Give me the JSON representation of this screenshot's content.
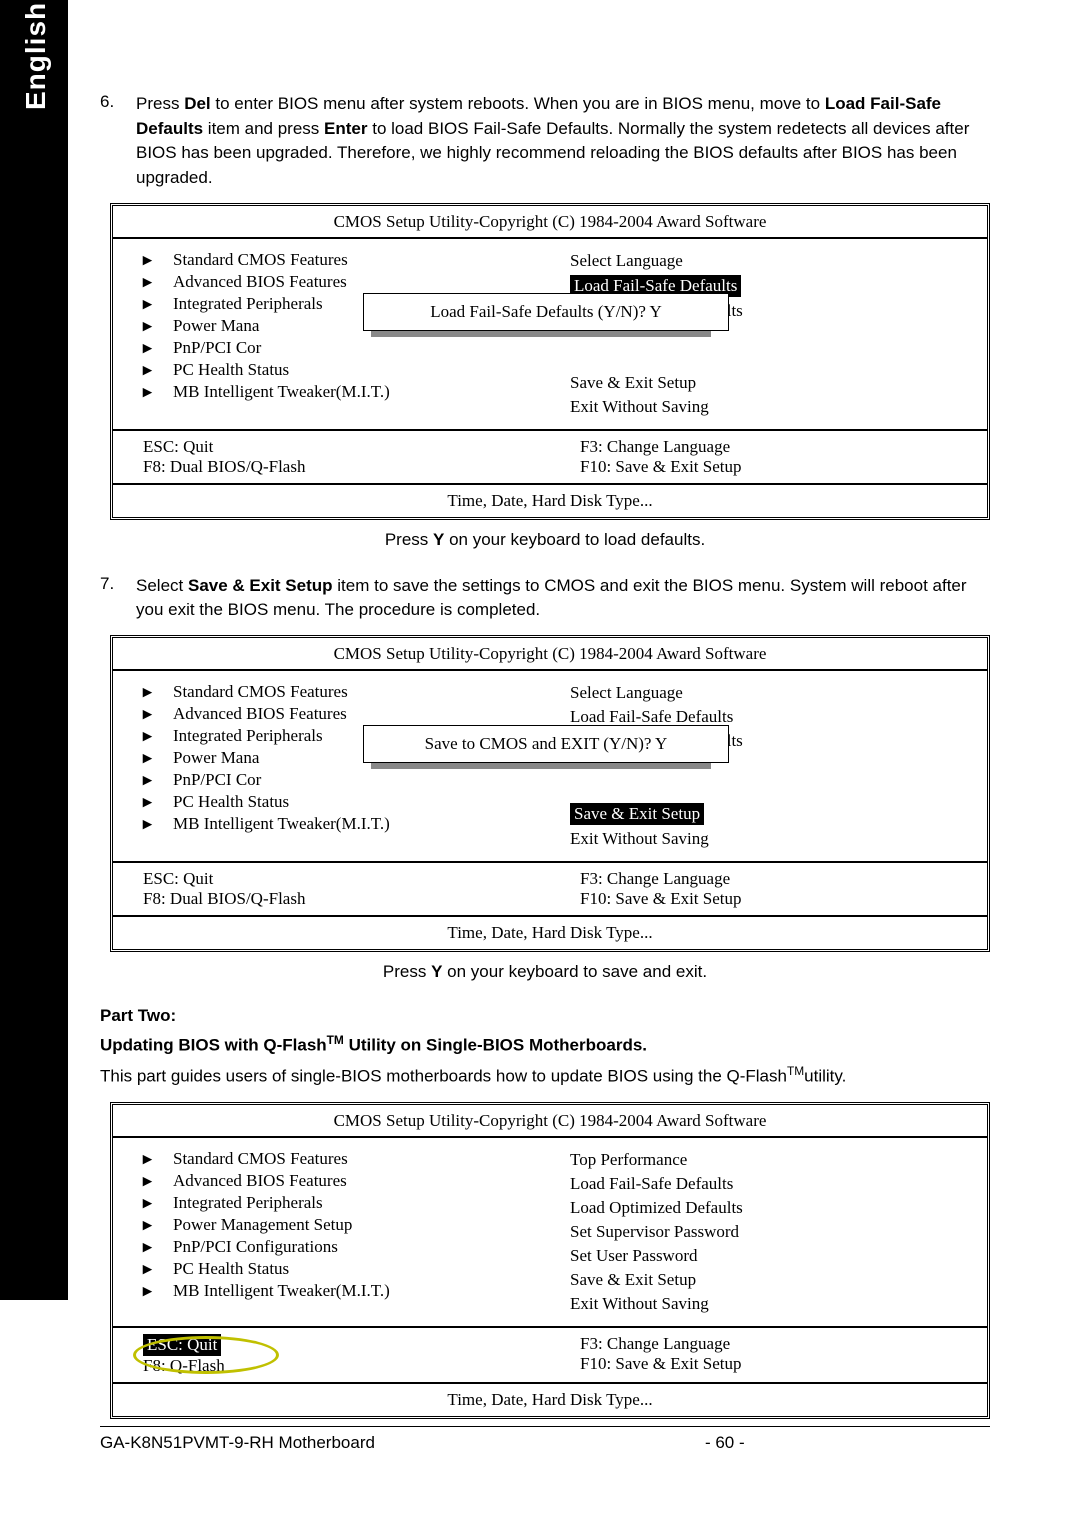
{
  "lang_tab": "English",
  "step6": {
    "num": "6.",
    "t1": "Press ",
    "del": "Del",
    "t2": " to enter BIOS menu after system reboots. When you are in BIOS menu, move to ",
    "lfsd": "Load Fail-Safe Defaults",
    "t3": " item and press ",
    "enter": "Enter",
    "t4": " to load BIOS Fail-Safe Defaults. Normally the system redetects all devices after BIOS has been upgraded. Therefore, we highly recommend reloading the BIOS defaults after BIOS has been upgraded."
  },
  "bios_common": {
    "title": "CMOS Setup Utility-Copyright (C) 1984-2004 Award Software",
    "left": [
      "Standard CMOS Features",
      "Advanced BIOS Features",
      "Integrated Peripherals",
      "Power Mana",
      "PnP/PCI Cor",
      "PC Health Status",
      "MB Intelligent Tweaker(M.I.T.)"
    ],
    "left_full": [
      "Standard CMOS Features",
      "Advanced BIOS Features",
      "Integrated Peripherals",
      "Power Management Setup",
      "PnP/PCI Configurations",
      "PC Health Status",
      "MB Intelligent Tweaker(M.I.T.)"
    ],
    "keys": {
      "esc": "ESC: Quit",
      "f8a": "F8: Dual BIOS/Q-Flash",
      "f8b": "F8: Q-Flash",
      "f3": "F3: Change Language",
      "f10": "F10: Save & Exit Setup"
    },
    "footer": "Time, Date, Hard Disk Type..."
  },
  "bios1": {
    "right": [
      "Select Language",
      "Load Fail-Safe Defaults",
      "Load Optimized Defaults",
      "",
      "",
      "Save & Exit Setup",
      "Exit Without Saving"
    ],
    "dialog": "Load Fail-Safe Defaults (Y/N)? Y",
    "caption_pre": "Press ",
    "caption_key": "Y",
    "caption_post": " on your keyboard to load defaults."
  },
  "step7": {
    "num": "7.",
    "t1": "Select ",
    "ses": "Save & Exit Setup",
    "t2": " item to save the settings to CMOS and exit the BIOS menu. System will reboot after you exit the BIOS menu. The procedure is completed."
  },
  "bios2": {
    "right": [
      "Select Language",
      "Load Fail-Safe Defaults",
      "Load Optimized Defaults",
      "",
      "",
      "Save & Exit Setup",
      "Exit Without Saving"
    ],
    "dialog": "Save to CMOS and EXIT (Y/N)? Y",
    "caption_pre": "Press ",
    "caption_key": "Y",
    "caption_post": " on your keyboard to save and exit."
  },
  "part2": {
    "title": "Part Two:",
    "sub_pre": "Updating BIOS with Q-Flash",
    "sub_tm": "TM",
    "sub_post": " Utility on Single-BIOS Motherboards.",
    "desc_pre": "This part guides users of single-BIOS motherboards how to update BIOS using the Q-Flash",
    "desc_tm": "TM",
    "desc_post": "utility."
  },
  "bios3": {
    "right": [
      "Top Performance",
      "Load Fail-Safe Defaults",
      "Load Optimized Defaults",
      "Set Supervisor Password",
      "Set User Password",
      "Save & Exit Setup",
      "Exit Without Saving"
    ],
    "esc": "ESC: Quit"
  },
  "footer": {
    "model": "GA-K8N51PVMT-9-RH Motherboard",
    "page": "- 60 -"
  }
}
